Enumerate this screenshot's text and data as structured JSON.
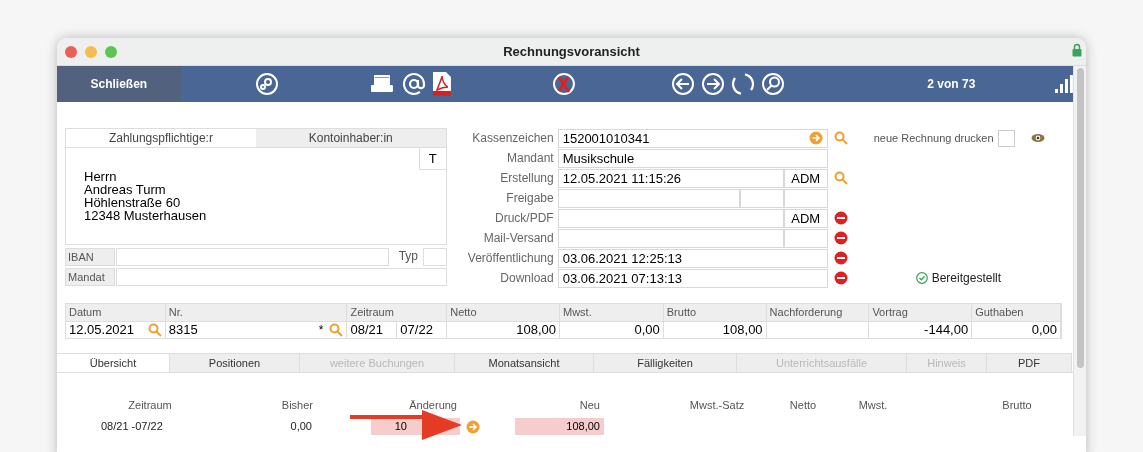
{
  "window": {
    "title": "Rechnungsvoransicht"
  },
  "toolbar": {
    "close_button": "Schließen",
    "counter": "2 von 73"
  },
  "address": {
    "tabs": [
      {
        "label": "Zahlungspflichtige:r",
        "selected": true
      },
      {
        "label": "Kontoinhaber:in",
        "selected": false
      }
    ],
    "t_button": "T",
    "lines": [
      "Herrn",
      "Andreas Turm",
      "Höhlenstraße 60",
      "12348 Musterhausen"
    ],
    "iban_label": "IBAN",
    "typ_label": "Typ",
    "mandat_label": "Mandat"
  },
  "form": [
    {
      "label": "Kassenzeichen",
      "kind": "plain",
      "value": "152001010341",
      "goto": true,
      "search": true,
      "delete": false
    },
    {
      "label": "Mandant",
      "kind": "plain",
      "value": "Musikschule",
      "goto": false,
      "search": false,
      "delete": false
    },
    {
      "label": "Erstellung",
      "kind": "user",
      "value": "12.05.2021 11:15:26",
      "user": "ADM",
      "goto": false,
      "search": true,
      "delete": false
    },
    {
      "label": "Freigabe",
      "kind": "triple",
      "goto": false,
      "search": false,
      "delete": false
    },
    {
      "label": "Druck/PDF",
      "kind": "user",
      "user": "ADM",
      "goto": false,
      "search": false,
      "delete": true
    },
    {
      "label": "Mail-Versand",
      "kind": "user",
      "goto": false,
      "search": false,
      "delete": true
    },
    {
      "label": "Veröffentlichung",
      "kind": "plain",
      "value": "03.06.2021 12:25:13",
      "goto": false,
      "search": false,
      "delete": true
    },
    {
      "label": "Download",
      "kind": "plain",
      "value": "03.06.2021 07:13:13",
      "goto": false,
      "search": false,
      "delete": true
    }
  ],
  "print_new": {
    "label": "neue Rechnung drucken",
    "checked": false
  },
  "status": "Bereitgestellt",
  "invoice_table": {
    "columns": [
      "Datum",
      "Nr.",
      "Zeitraum",
      "Netto",
      "Mwst.",
      "Brutto",
      "Nachforderung",
      "Vortrag",
      "Guthaben"
    ],
    "cells": [
      {
        "value": "12.05.2021",
        "search": true
      },
      {
        "value": "8315",
        "mark": "*",
        "search": true
      },
      {
        "value": "08/21"
      },
      {
        "value": "07/22"
      },
      {
        "value": "108,00"
      },
      {
        "value": "0,00"
      },
      {
        "value": "108,00"
      },
      {},
      {
        "value": "-144,00"
      },
      {
        "value": "0,00"
      }
    ]
  },
  "tabs": [
    {
      "label": "Übersicht",
      "selected": true,
      "disabled": false
    },
    {
      "label": "Positionen",
      "selected": false,
      "disabled": false
    },
    {
      "label": "weitere Buchungen",
      "selected": false,
      "disabled": true
    },
    {
      "label": "Monatsansicht",
      "selected": false,
      "disabled": false
    },
    {
      "label": "Fälligkeiten",
      "selected": false,
      "disabled": false
    },
    {
      "label": "Unterrichtsausfälle",
      "selected": false,
      "disabled": true
    },
    {
      "label": "Hinweis",
      "selected": false,
      "disabled": true
    },
    {
      "label": "PDF",
      "selected": false,
      "disabled": false
    }
  ],
  "summary": {
    "columns": [
      "Zeitraum",
      "Bisher",
      "Änderung",
      "Neu",
      "Mwst.-Satz",
      "Netto",
      "Mwst.",
      "Brutto"
    ],
    "row": {
      "zeitraum": "08/21 -07/22",
      "bisher": "0,00",
      "aenderung": "10",
      "neu": "108,00"
    }
  }
}
